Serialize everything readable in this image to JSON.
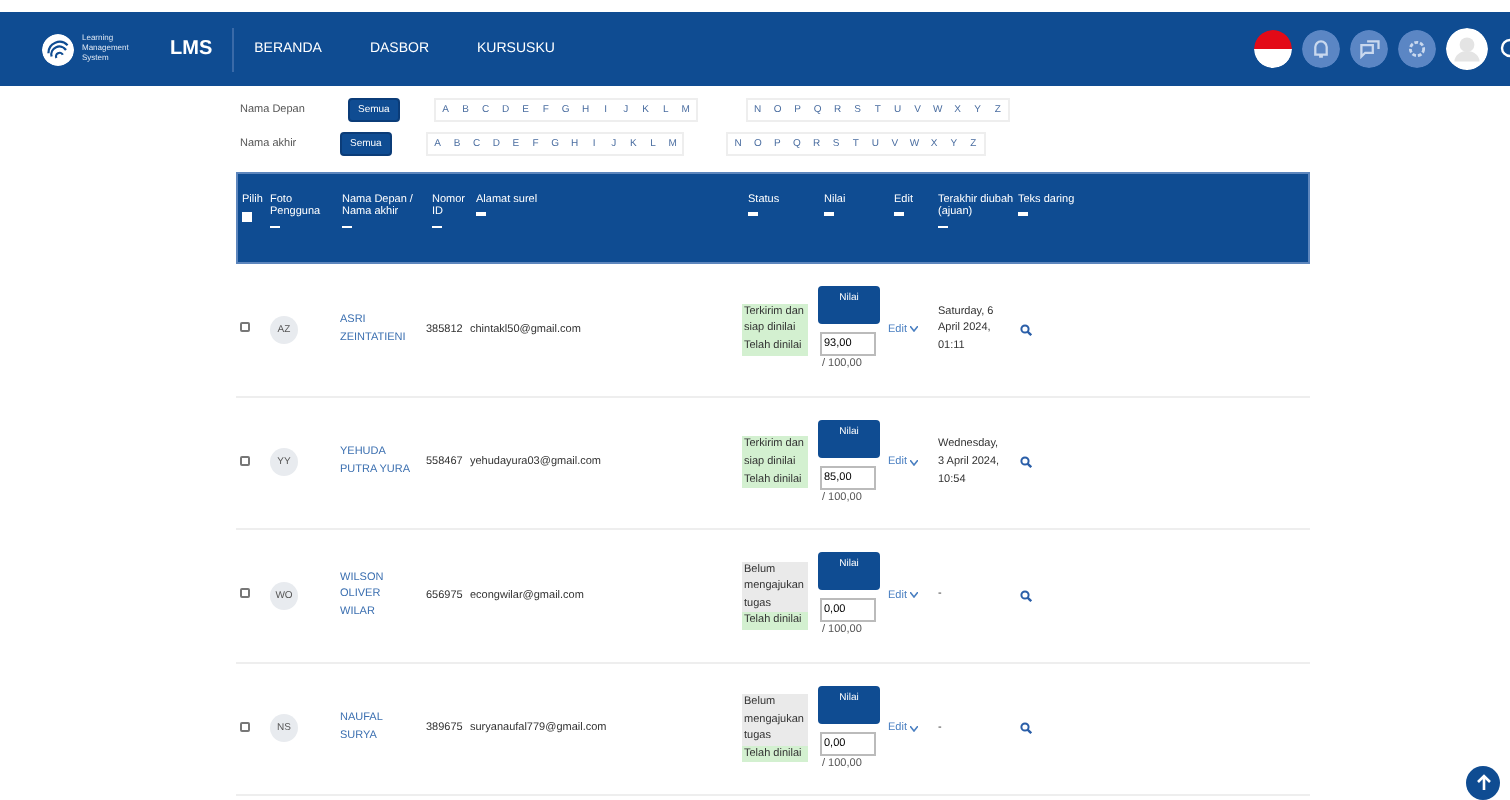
{
  "navbar": {
    "logo_text": "Learning Management System",
    "brand": "LMS",
    "menu": [
      {
        "label": "BERANDA"
      },
      {
        "label": "DASBOR"
      },
      {
        "label": "KURSUSKU"
      }
    ]
  },
  "filters": [
    {
      "label": "Nama Depan",
      "all": {
        "label": "Semua",
        "selected": true
      },
      "letters": [
        "A",
        "B",
        "C",
        "D",
        "E",
        "F",
        "G",
        "H",
        "I",
        "J",
        "K",
        "L",
        "M",
        "N",
        "O",
        "P",
        "Q",
        "R",
        "S",
        "T",
        "U",
        "V",
        "W",
        "X",
        "Y",
        "Z"
      ]
    },
    {
      "label": "Nama akhir",
      "all": {
        "label": "Semua",
        "selected": true
      },
      "letters": [
        "A",
        "B",
        "C",
        "D",
        "E",
        "F",
        "G",
        "H",
        "I",
        "J",
        "K",
        "L",
        "M",
        "N",
        "O",
        "P",
        "Q",
        "R",
        "S",
        "T",
        "U",
        "V",
        "W",
        "X",
        "Y",
        "Z"
      ]
    }
  ],
  "table": {
    "select_all": false,
    "columns": [
      "Pilih",
      "Foto Pengguna",
      "Nama Depan / Nama akhir",
      "Nomor ID",
      "Alamat surel",
      "Status",
      "Nilai",
      "Edit",
      "Terakhir diubah (ajuan)",
      "Teks daring"
    ],
    "rows": [
      {
        "selected": false,
        "initials": "AZ",
        "name": "ASRI ZEINTATIENI",
        "id": "385812",
        "email": "chintakl50@gmail.com",
        "status": [
          {
            "text": "Terkirim dan siap dinilai",
            "kind": "submitted"
          },
          {
            "text": "Telah dinilai",
            "kind": "graded"
          }
        ],
        "grade_button": "Nilai",
        "grade": "93,00",
        "max": "/ 100,00",
        "edit": "Edit",
        "modified": "Saturday, 6 April 2024, 01:11"
      },
      {
        "selected": false,
        "initials": "YY",
        "name": "YEHUDA PUTRA YURA",
        "id": "558467",
        "email": "yehudayura03@gmail.com",
        "status": [
          {
            "text": "Terkirim dan siap dinilai",
            "kind": "submitted"
          },
          {
            "text": "Telah dinilai",
            "kind": "graded"
          }
        ],
        "grade_button": "Nilai",
        "grade": "85,00",
        "max": "/ 100,00",
        "edit": "Edit",
        "modified": "Wednesday, 3 April 2024, 10:54"
      },
      {
        "selected": false,
        "initials": "WO",
        "name": "WILSON OLIVER WILAR",
        "id": "656975",
        "email": "econgwilar@gmail.com",
        "status": [
          {
            "text": "Belum mengajukan tugas",
            "kind": "not_submitted"
          },
          {
            "text": "Telah dinilai",
            "kind": "graded"
          }
        ],
        "grade_button": "Nilai",
        "grade": "0,00",
        "max": "/ 100,00",
        "edit": "Edit",
        "modified": "-"
      },
      {
        "selected": false,
        "initials": "NS",
        "name": "NAUFAL SURYA",
        "id": "389675",
        "email": "suryanaufal779@gmail.com",
        "status": [
          {
            "text": "Belum mengajukan tugas",
            "kind": "not_submitted"
          },
          {
            "text": "Telah dinilai",
            "kind": "graded"
          }
        ],
        "grade_button": "Nilai",
        "grade": "0,00",
        "max": "/ 100,00",
        "edit": "Edit",
        "modified": "-"
      }
    ]
  }
}
